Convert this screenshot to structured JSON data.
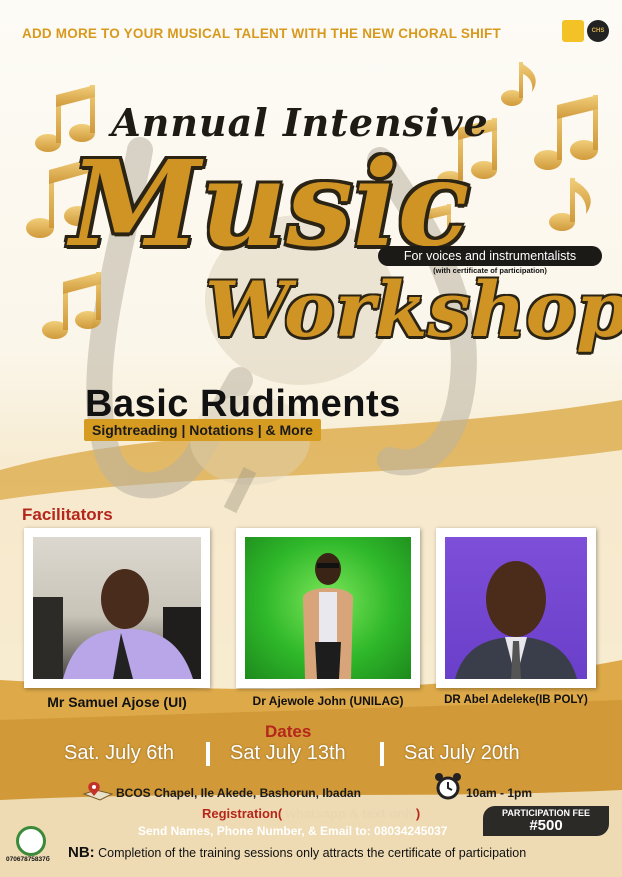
{
  "header": {
    "banner": "ADD MORE TO YOUR MUSICAL TALENT WITH THE NEW CHORAL SHIFT",
    "logo_left_text": "",
    "logo_right_text": "CHS"
  },
  "title": {
    "line1": "Annual Intensive",
    "line2": "Music",
    "line3": "Workshop"
  },
  "subtitle": {
    "audience": "For voices and instrumentalists",
    "certificate_note": "(with certificate of participation)"
  },
  "course": {
    "heading": "Basic Rudiments",
    "topics": "Sightreading | Notations  | & More"
  },
  "facilitators": {
    "heading": "Facilitators",
    "people": [
      {
        "name": "Mr Samuel Ajose (UI)"
      },
      {
        "name": "Dr Ajewole John (UNILAG)"
      },
      {
        "name": "DR Abel Adeleke(IB POLY)"
      }
    ]
  },
  "dates": {
    "heading": "Dates",
    "items": [
      "Sat. July 6th",
      "Sat July 13th",
      "Sat July 20th"
    ]
  },
  "venue": {
    "address": "BCOS Chapel, Ile Akede, Bashorun, Ibadan",
    "time": "10am - 1pm"
  },
  "registration": {
    "label_start": "Registration(",
    "label_highlight": " whatsapp & text only",
    "label_end": ")",
    "instructions": "Send Names, Phone Number, & Email to:  08034245037"
  },
  "fee": {
    "label": "PARTICIPATION FEE",
    "amount": "#500"
  },
  "footer": {
    "nb_label": "NB:",
    "nb_text": " Completion of the training sessions only attracts the certificate of participation",
    "phone": "07067875837б"
  },
  "colors": {
    "gold": "#cf9424",
    "red": "#b5261c",
    "dark": "#1c1a17"
  }
}
